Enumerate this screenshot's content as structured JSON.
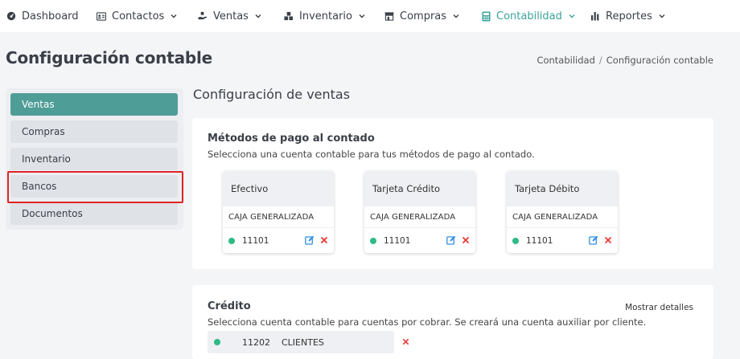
{
  "nav": {
    "items": [
      {
        "label": "Dashboard",
        "icon": "dashboard-icon",
        "has_chevron": false
      },
      {
        "label": "Contactos",
        "icon": "contacts-card-icon",
        "has_chevron": true
      },
      {
        "label": "Ventas",
        "icon": "sales-hand-icon",
        "has_chevron": true
      },
      {
        "label": "Inventario",
        "icon": "inventory-boxes-icon",
        "has_chevron": true
      },
      {
        "label": "Compras",
        "icon": "store-icon",
        "has_chevron": true
      },
      {
        "label": "Contabilidad",
        "icon": "calculator-icon",
        "has_chevron": true,
        "active": true
      },
      {
        "label": "Reportes",
        "icon": "bar-chart-icon",
        "has_chevron": true
      }
    ]
  },
  "page": {
    "title": "Configuración contable",
    "breadcrumb": [
      "Contabilidad",
      "Configuración contable"
    ],
    "breadcrumb_sep": "/"
  },
  "sidebar": {
    "items": [
      {
        "label": "Ventas",
        "active": true
      },
      {
        "label": "Compras"
      },
      {
        "label": "Inventario"
      },
      {
        "label": "Bancos",
        "highlighted": true
      },
      {
        "label": "Documentos"
      }
    ]
  },
  "main": {
    "section_title": "Configuración de ventas",
    "cash_methods": {
      "title": "Métodos de pago al contado",
      "subtitle": "Selecciona una cuenta contable para tus métodos de pago al contado.",
      "methods": [
        {
          "name": "Efectivo",
          "account_name": "CAJA GENERALIZADA",
          "account_code": "11101"
        },
        {
          "name": "Tarjeta Crédito",
          "account_name": "CAJA GENERALIZADA",
          "account_code": "11101"
        },
        {
          "name": "Tarjeta Débito",
          "account_name": "CAJA GENERALIZADA",
          "account_code": "11101"
        }
      ]
    },
    "credit": {
      "title": "Crédito",
      "subtitle": "Selecciona cuenta contable para cuentas por cobrar. Se creará una cuenta auxiliar por cliente.",
      "show_details_label": "Mostrar detalles",
      "account_code": "11202",
      "account_name": "CLIENTES"
    }
  },
  "colors": {
    "accent": "#3aa39a",
    "sidebar_active": "#4f9d97",
    "status_green": "#2dbb84",
    "delete_red": "#e53935",
    "edit_blue": "#2f8de4",
    "highlight_red": "#e02424"
  }
}
